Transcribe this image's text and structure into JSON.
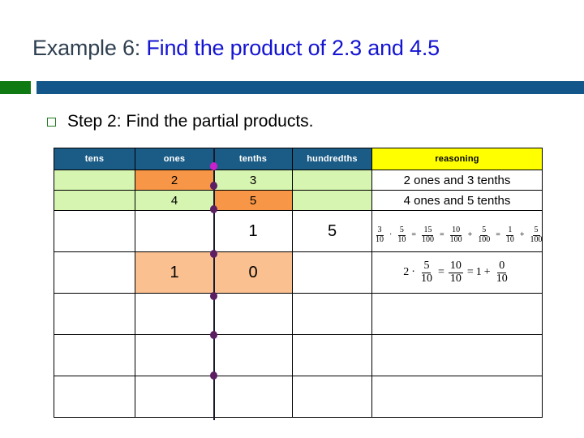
{
  "slide": {
    "title_lead": "Example 6:",
    "title_main": " Find the product of 2.3 and 4.5",
    "step_text": "Step 2: Find the partial products.",
    "bullet_icon": "square-bullet-icon",
    "colors": {
      "title_lead": "#2f4050",
      "title_main": "#1414d2",
      "divider_green": "#0f7a12",
      "divider_blue": "#13578a",
      "header_blue": "#1b5c87",
      "header_yellow": "#ffff00",
      "fill_green": "#d6f5b0",
      "fill_orange": "#f79646",
      "fill_peach": "#fac090",
      "decimal_dot": "#5b1f62",
      "decimal_dot_bright": "#cc1fcc"
    }
  },
  "table": {
    "headers": [
      "tens",
      "ones",
      "tenths",
      "hundredths",
      "reasoning"
    ],
    "rows": [
      {
        "tens": "",
        "ones": "2",
        "tenths": "3",
        "hundredths": "",
        "reasoning": "2 ones and 3 tenths"
      },
      {
        "tens": "",
        "ones": "4",
        "tenths": "5",
        "hundredths": "",
        "reasoning": "4 ones and 5 tenths"
      },
      {
        "tens": "",
        "ones": "",
        "tenths": "1",
        "hundredths": "5",
        "reasoning": ""
      },
      {
        "tens": "",
        "ones": "1",
        "tenths": "0",
        "hundredths": "",
        "reasoning": ""
      },
      {
        "tens": "",
        "ones": "",
        "tenths": "",
        "hundredths": "",
        "reasoning": ""
      },
      {
        "tens": "",
        "ones": "",
        "tenths": "",
        "hundredths": "",
        "reasoning": ""
      },
      {
        "tens": "",
        "ones": "",
        "tenths": "",
        "hundredths": "",
        "reasoning": ""
      }
    ],
    "math": {
      "row3": {
        "f1_n": "3",
        "f1_d": "10",
        "op1": "·",
        "f2_n": "5",
        "f2_d": "10",
        "eq1": "=",
        "f3_n": "15",
        "f3_d": "100",
        "eq2": "=",
        "f4_n": "10",
        "f4_d": "100",
        "plus1": "+",
        "f5_n": "5",
        "f5_d": "100",
        "eq3": "=",
        "f6_n": "1",
        "f6_d": "10",
        "plus2": "+",
        "f7_n": "5",
        "f7_d": "100"
      },
      "row4": {
        "lead": "2",
        "op1": "·",
        "f1_n": "5",
        "f1_d": "10",
        "eq1": "=",
        "f2_n": "10",
        "f2_d": "10",
        "eq2": "=",
        "one": "1",
        "plus1": "+",
        "f3_n": "0",
        "f3_d": "10"
      }
    }
  }
}
